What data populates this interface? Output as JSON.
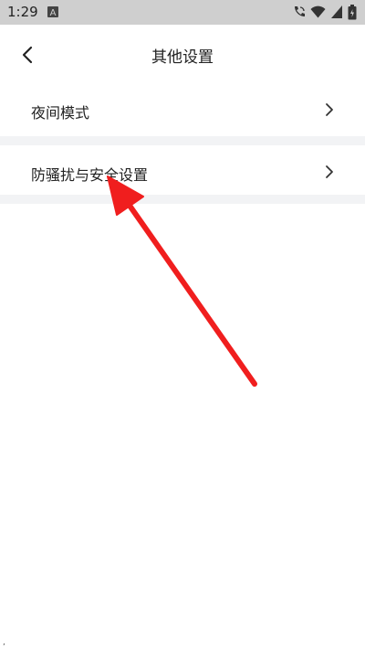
{
  "status_bar": {
    "time": "1:29",
    "left_icons": [
      "a-notification-icon"
    ],
    "right_icons": [
      "wifi-call-icon",
      "wifi-icon",
      "signal-icon",
      "battery-icon"
    ]
  },
  "header": {
    "title": "其他设置",
    "back_icon": "chevron-left-icon"
  },
  "settings": {
    "items": [
      {
        "label": "夜间模式",
        "icon": "chevron-right-icon"
      },
      {
        "label": "防骚扰与安全设置",
        "icon": "chevron-right-icon"
      }
    ]
  },
  "annotation": {
    "color": "#f01e1e",
    "type": "red-arrow-pointer"
  }
}
